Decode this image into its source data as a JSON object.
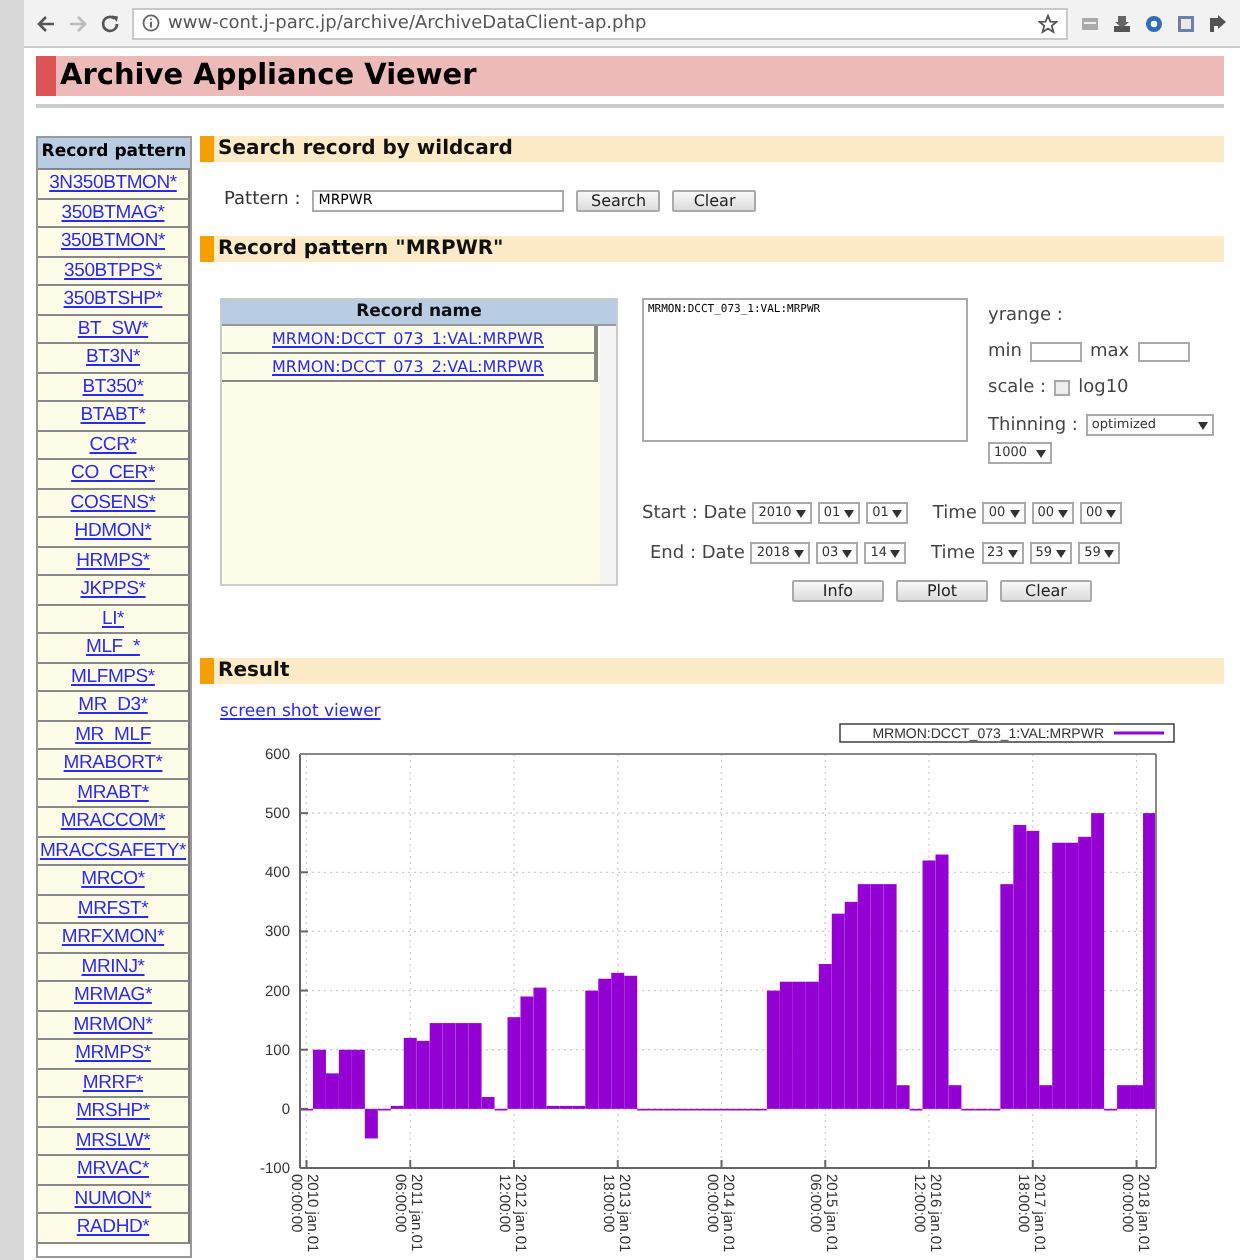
{
  "browser": {
    "url": "www-cont.j-parc.jp/archive/ArchiveDataClient-ap.php",
    "forward_disabled": true
  },
  "header": {
    "title": "Archive Appliance Viewer"
  },
  "sidebar": {
    "title": "Record pattern",
    "items": [
      "3N350BTMON*",
      "350BTMAG*",
      "350BTMON*",
      "350BTPPS*",
      "350BTSHP*",
      "BT_SW*",
      "BT3N*",
      "BT350*",
      "BTABT*",
      "CCR*",
      "CO_CER*",
      "COSENS*",
      "HDMON*",
      "HRMPS*",
      "JKPPS*",
      "LI*",
      "MLF_*",
      "MLFMPS*",
      "MR_D3*",
      "MR_MLF",
      "MRABORT*",
      "MRABT*",
      "MRACCOM*",
      "MRACCSAFETY*",
      "MRCO*",
      "MRFST*",
      "MRFXMON*",
      "MRINJ*",
      "MRMAG*",
      "MRMON*",
      "MRMPS*",
      "MRRF*",
      "MRSHP*",
      "MRSLW*",
      "MRVAC*",
      "NUMON*",
      "RADHD*"
    ]
  },
  "search_section": {
    "title": "Search record by wildcard",
    "pattern_label": "Pattern :",
    "pattern_value": "MRPWR",
    "buttons": [
      "Search",
      "Clear"
    ]
  },
  "record_section": {
    "title": "Record pattern \"MRPWR\"",
    "table": {
      "column": "Record name",
      "rows": [
        "MRMON:DCCT_073_1:VAL:MRPWR",
        "MRMON:DCCT_073_2:VAL:MRPWR"
      ]
    },
    "selection_text": "MRMON:DCCT_073_1:VAL:MRPWR",
    "yrange_label": "yrange :",
    "min_label": "min",
    "max_label": "max",
    "scale_label": "scale :",
    "log10": {
      "label": "log10",
      "checked": false
    },
    "thinning_label": "Thinning :",
    "thinning_mode": "optimized",
    "thinning_points": "1000",
    "start": {
      "label": "Start : Date",
      "date": [
        "2010",
        "01",
        "01"
      ],
      "time_label": "Time",
      "time": [
        "00",
        "00",
        "00"
      ]
    },
    "end": {
      "label": "End : Date",
      "date": [
        "2018",
        "03",
        "14"
      ],
      "time_label": "Time",
      "time": [
        "23",
        "59",
        "59"
      ]
    },
    "buttons": [
      "Info",
      "Plot",
      "Clear"
    ]
  },
  "result_section": {
    "title": "Result",
    "link": "screen shot viewer",
    "chart_data": {
      "type": "bar",
      "grid": true,
      "categories": [
        "2010 jan.01\n00:00:00",
        null,
        null,
        null,
        null,
        null,
        null,
        null,
        "2011 jan.01\n06:00:00",
        null,
        null,
        null,
        null,
        null,
        null,
        null,
        "2012 jan.01\n12:00:00",
        null,
        null,
        null,
        null,
        null,
        null,
        null,
        "2013 jan.01\n18:00:00",
        null,
        null,
        null,
        null,
        null,
        null,
        null,
        "2014 jan.01\n00:00:00",
        null,
        null,
        null,
        null,
        null,
        null,
        null,
        "2015 jan.01\n06:00:00",
        null,
        null,
        null,
        null,
        null,
        null,
        null,
        "2016 jan.01\n12:00:00",
        null,
        null,
        null,
        null,
        null,
        null,
        null,
        "2017 jan.01\n18:00:00",
        null,
        null,
        null,
        null,
        null,
        null,
        null,
        "2018 jan.01\n00:00:00",
        null
      ],
      "ylim": [
        -100,
        600
      ],
      "series": [
        {
          "name": "MRMON:DCCT_073_1:VAL:MRPWR",
          "color": "#9400d3",
          "values": [
            0,
            100,
            60,
            100,
            100,
            -50,
            0,
            5,
            120,
            115,
            145,
            145,
            145,
            145,
            20,
            0,
            155,
            190,
            205,
            5,
            5,
            5,
            200,
            220,
            230,
            225,
            0,
            0,
            0,
            0,
            0,
            0,
            0,
            0,
            0,
            0,
            200,
            215,
            215,
            215,
            245,
            330,
            350,
            380,
            380,
            380,
            40,
            0,
            420,
            430,
            40,
            0,
            0,
            0,
            380,
            480,
            470,
            40,
            450,
            450,
            460,
            500,
            0,
            40,
            40,
            500
          ]
        }
      ],
      "yticks": [
        -100,
        0,
        100,
        200,
        300,
        400,
        500,
        600
      ]
    }
  }
}
